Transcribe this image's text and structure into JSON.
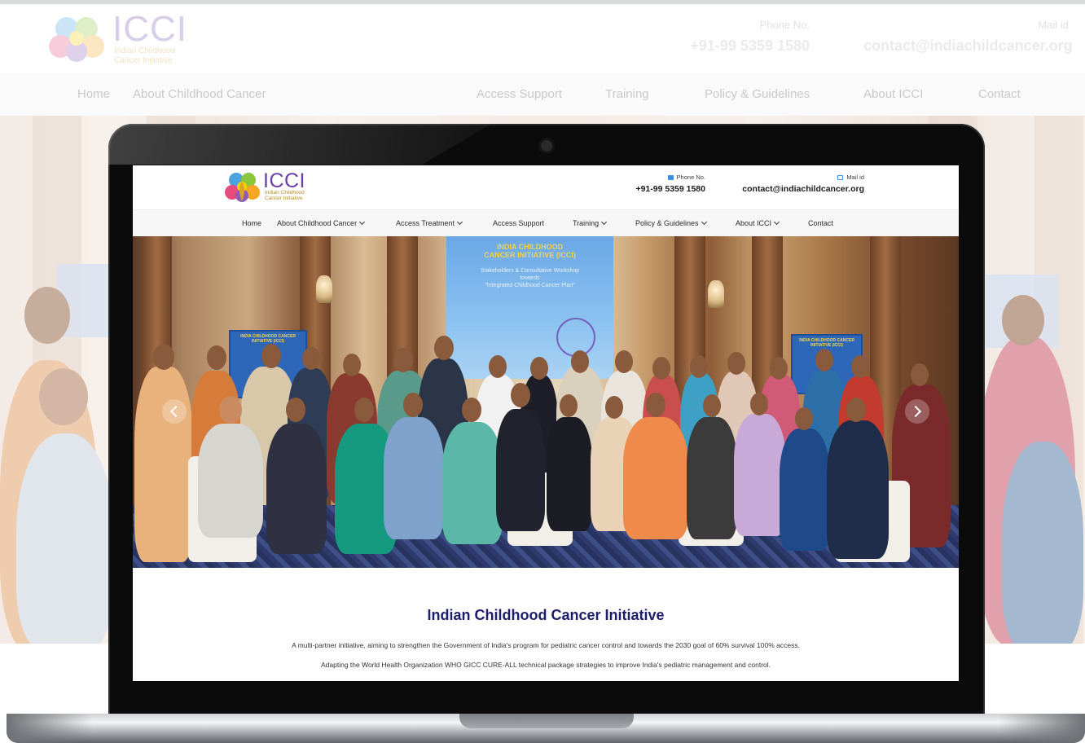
{
  "site": {
    "logo_text": "ICCI",
    "logo_subtitle_line1": "Indian Childhood",
    "logo_subtitle_line2": "Cancer Initiative",
    "phone_label": "Phone No.",
    "phone_value": "+91-99 5359 1580",
    "mail_label": "Mail id",
    "mail_value": "contact@indiachildcancer.org",
    "nav": [
      {
        "label": "Home"
      },
      {
        "label": "About Childhood Cancer"
      },
      {
        "label": "Access Treatment"
      },
      {
        "label": "Access Support"
      },
      {
        "label": "Training"
      },
      {
        "label": "Policy & Guidelines"
      },
      {
        "label": "About ICCI"
      },
      {
        "label": "Contact"
      }
    ],
    "hero": {
      "screen_line1": "INDIA CHILDHOOD",
      "screen_line2": "CANCER INITIATIVE (ICCI)",
      "screen_line3": "Stakeholders & Consultative Workshop",
      "screen_line4": "towards",
      "screen_line5": "\"Integrated Childhood Cancer Plan\"",
      "banner_text": "INDIA CHILDHOOD CANCER INITIATIVE (ICCI)"
    },
    "heading": "Indian Childhood Cancer Initiative",
    "paragraph1": "A multi-partner initiative, aiming to strengthen the Government of India's program for pediatric cancer control and towards the 2030 goal of 60% survival 100% access.",
    "paragraph2": "Adapting the World Health Organization WHO GICC CURE-ALL technical package strategies to improve India's pediatric management and control."
  },
  "colors": {
    "brand_purple": "#6c3fa6",
    "brand_gold": "#b98c22",
    "heading_navy": "#1d1d6b",
    "icon_blue": "#3b8ee8"
  }
}
